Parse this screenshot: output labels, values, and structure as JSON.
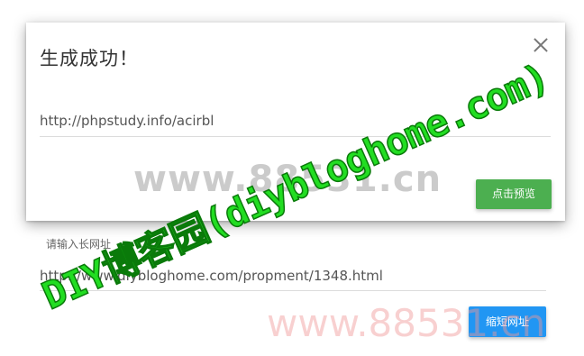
{
  "form": {
    "label": "请输入长网址",
    "long_url": "http://www.diybloghome.com/propment/1348.html",
    "shorten_button": "缩短网址"
  },
  "modal": {
    "title": "生成成功！",
    "short_url": "http://phpstudy.info/acirbl",
    "preview_button": "点击预览"
  },
  "watermarks": {
    "gray": "www.88531.cn",
    "pink": "www.88531.cn",
    "green": "DIY博客园(diybloghome.com)"
  },
  "colors": {
    "primary_blue": "#2196f3",
    "success_green": "#4caf50",
    "watermark_green": "#22dd22"
  },
  "icons": {
    "close": "close-icon"
  }
}
